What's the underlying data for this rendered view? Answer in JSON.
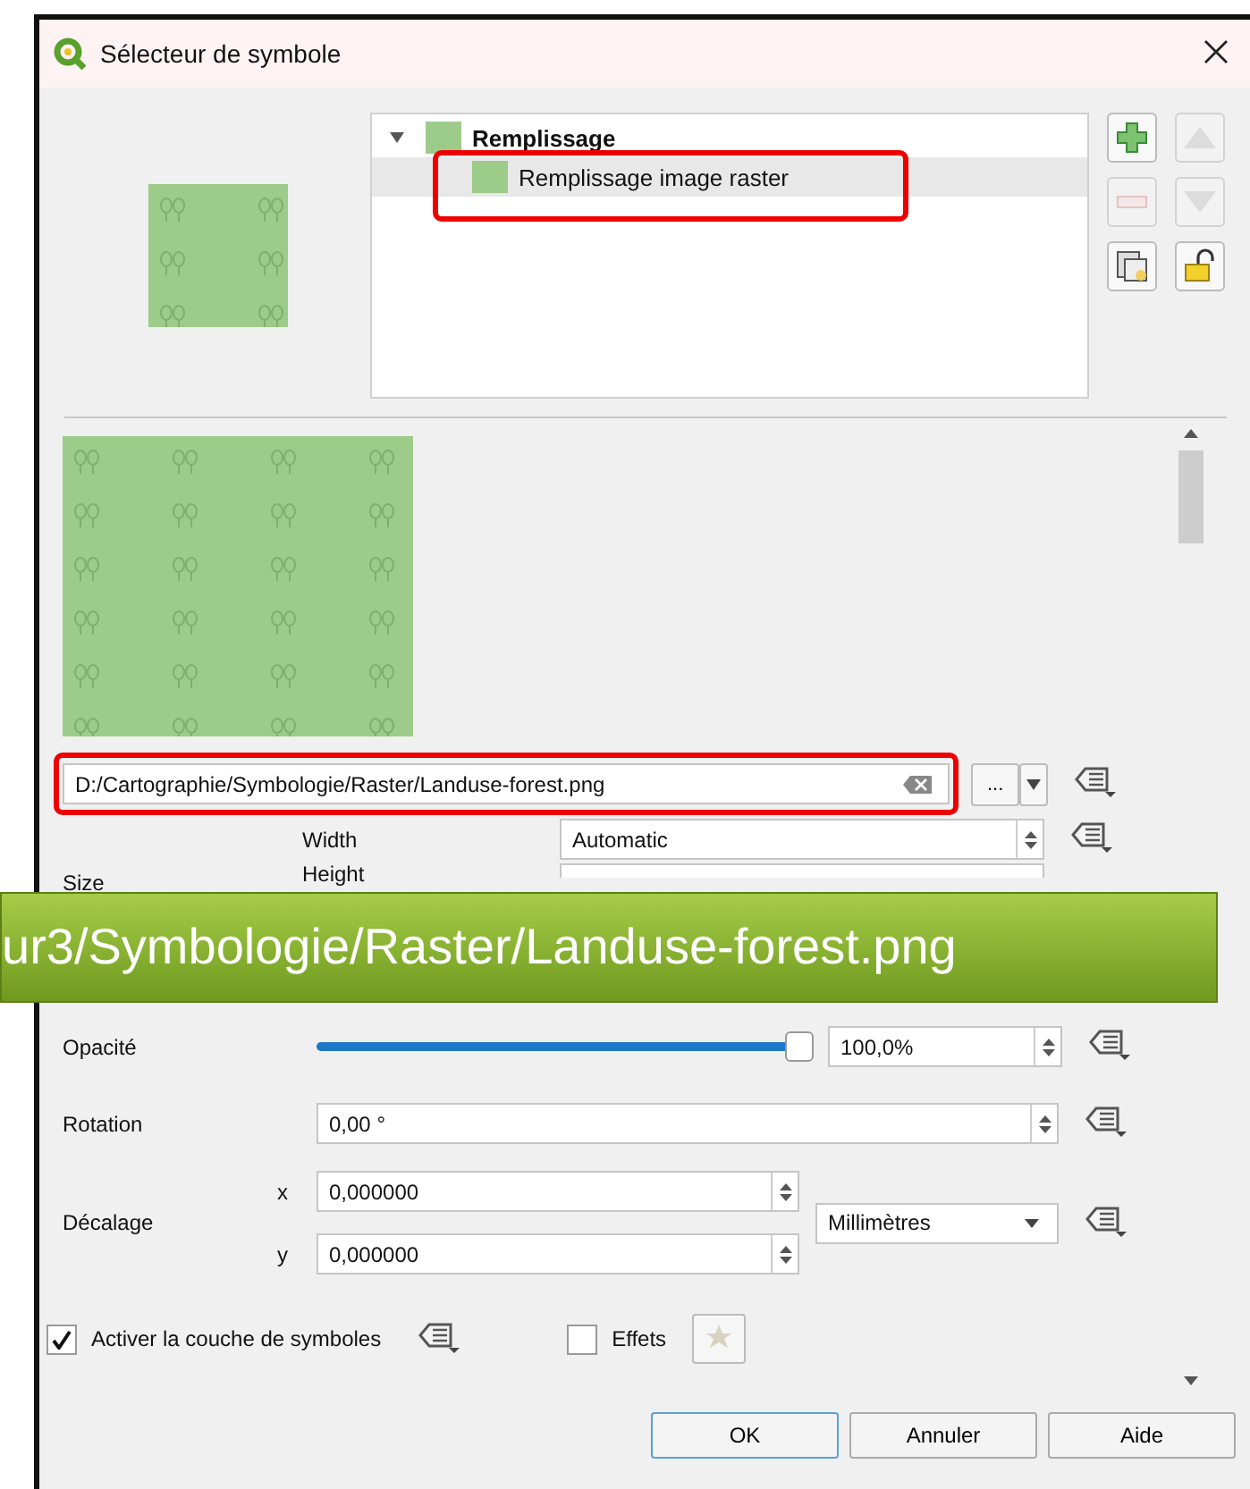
{
  "window": {
    "title": "Sélecteur de symbole"
  },
  "layer_tree": [
    {
      "label": "Remplissage",
      "expanded": true,
      "selected": false,
      "highlighted": false,
      "children": [
        {
          "label": "Remplissage image raster",
          "selected": true,
          "highlighted": true
        }
      ]
    }
  ],
  "tools": [
    {
      "kind": "add",
      "disabled": false
    },
    {
      "kind": "up",
      "disabled": true
    },
    {
      "kind": "remove",
      "disabled": true
    },
    {
      "kind": "down",
      "disabled": true
    },
    {
      "kind": "duplicate",
      "disabled": false
    },
    {
      "kind": "lock",
      "disabled": false
    }
  ],
  "file": {
    "value": "D:/Cartographie/Symbologie/Raster/Landuse-forest.png",
    "highlighted": true,
    "browse_button": "..."
  },
  "size": {
    "label": "Size",
    "width_label": "Width",
    "width_value": "Automatic",
    "height_label": "Height"
  },
  "opacity": {
    "label": "Opacité",
    "level": 1,
    "value": "100,0%"
  },
  "rotation": {
    "label": "Rotation",
    "value": "0,00 °"
  },
  "offset": {
    "label": "Décalage",
    "x_label": "x",
    "x_value": "0,000000",
    "y_label": "y",
    "y_value": "0,000000",
    "unit": "Millimètres"
  },
  "enable_layer": {
    "label": "Activer la couche de symboles",
    "checked": true
  },
  "effects": {
    "label": "Effets",
    "checked": false
  },
  "buttons": [
    {
      "label": "OK",
      "default": true
    },
    {
      "label": "Annuler",
      "default": false
    },
    {
      "label": "Aide",
      "default": false
    }
  ],
  "banner": {
    "text": "ur3/Symbologie/Raster/Landuse-forest.png"
  }
}
